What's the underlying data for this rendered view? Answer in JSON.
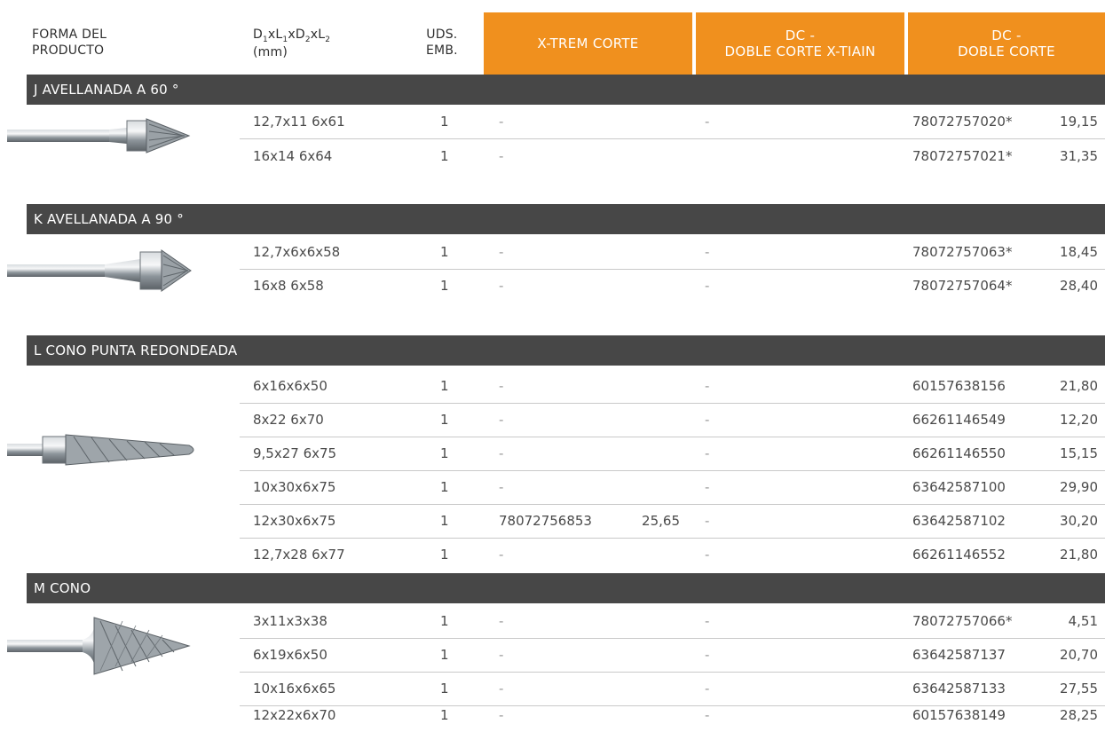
{
  "header": {
    "product_form": [
      "FORMA DEL",
      "PRODUCTO"
    ],
    "dimensions_line1_parts": [
      "D",
      "1",
      "xL",
      "1",
      "xD",
      "2",
      "xL",
      "2"
    ],
    "dimensions_line2": "(mm)",
    "units": [
      "UDS.",
      "EMB."
    ],
    "col_xtrem": "X-TREM CORTE",
    "col_dcx": [
      "DC -",
      "DOBLE CORTE X-TIAIN"
    ],
    "col_dc": [
      "DC -",
      "DOBLE CORTE"
    ]
  },
  "colors": {
    "accent_orange": "#f0901e",
    "section_bar": "#474747",
    "row_divider": "#c9c9c9"
  },
  "sections": [
    {
      "title": "J AVELLANADA A 60 °",
      "tool_icon": "countersink-60-burr-icon",
      "rows": [
        {
          "dim": "12,7x11 6x61",
          "uds": "1",
          "xt_code": "-",
          "xt_price": "",
          "dcx": "-",
          "dc_code": "78072757020*",
          "dc_price": "19,15"
        },
        {
          "dim": "16x14 6x64",
          "uds": "1",
          "xt_code": "-",
          "xt_price": "",
          "dcx": "",
          "dc_code": "78072757021*",
          "dc_price": "31,35"
        }
      ]
    },
    {
      "title": "K AVELLANADA A 90 °",
      "tool_icon": "countersink-90-burr-icon",
      "rows": [
        {
          "dim": "12,7x6x6x58",
          "uds": "1",
          "xt_code": "-",
          "xt_price": "",
          "dcx": "-",
          "dc_code": "78072757063*",
          "dc_price": "18,45"
        },
        {
          "dim": "16x8 6x58",
          "uds": "1",
          "xt_code": "-",
          "xt_price": "",
          "dcx": "-",
          "dc_code": "78072757064*",
          "dc_price": "28,40"
        }
      ]
    },
    {
      "title": "L CONO PUNTA REDONDEADA",
      "tool_icon": "round-tip-cone-burr-icon",
      "rows": [
        {
          "dim": "6x16x6x50",
          "uds": "1",
          "xt_code": "-",
          "xt_price": "",
          "dcx": "-",
          "dc_code": "60157638156",
          "dc_price": "21,80"
        },
        {
          "dim": "8x22 6x70",
          "uds": "1",
          "xt_code": "-",
          "xt_price": "",
          "dcx": "-",
          "dc_code": "66261146549",
          "dc_price": "12,20"
        },
        {
          "dim": "9,5x27 6x75",
          "uds": "1",
          "xt_code": "-",
          "xt_price": "",
          "dcx": "-",
          "dc_code": "66261146550",
          "dc_price": "15,15"
        },
        {
          "dim": "10x30x6x75",
          "uds": "1",
          "xt_code": "-",
          "xt_price": "",
          "dcx": "-",
          "dc_code": "63642587100",
          "dc_price": "29,90"
        },
        {
          "dim": "12x30x6x75",
          "uds": "1",
          "xt_code": "78072756853",
          "xt_price": "25,65",
          "dcx": "-",
          "dc_code": "63642587102",
          "dc_price": "30,20"
        },
        {
          "dim": "12,7x28 6x77",
          "uds": "1",
          "xt_code": "-",
          "xt_price": "",
          "dcx": "-",
          "dc_code": "66261146552",
          "dc_price": "21,80"
        }
      ]
    },
    {
      "title": "M CONO",
      "tool_icon": "cone-burr-icon",
      "rows": [
        {
          "dim": "3x11x3x38",
          "uds": "1",
          "xt_code": "-",
          "xt_price": "",
          "dcx": "-",
          "dc_code": "78072757066*",
          "dc_price": "4,51"
        },
        {
          "dim": "6x19x6x50",
          "uds": "1",
          "xt_code": "-",
          "xt_price": "",
          "dcx": "-",
          "dc_code": "63642587137",
          "dc_price": "20,70"
        },
        {
          "dim": "10x16x6x65",
          "uds": "1",
          "xt_code": "-",
          "xt_price": "",
          "dcx": "-",
          "dc_code": "63642587133",
          "dc_price": "27,55"
        },
        {
          "dim": "12x22x6x70",
          "uds": "1",
          "xt_code": "-",
          "xt_price": "",
          "dcx": "-",
          "dc_code": "60157638149",
          "dc_price": "28,25"
        }
      ]
    }
  ]
}
